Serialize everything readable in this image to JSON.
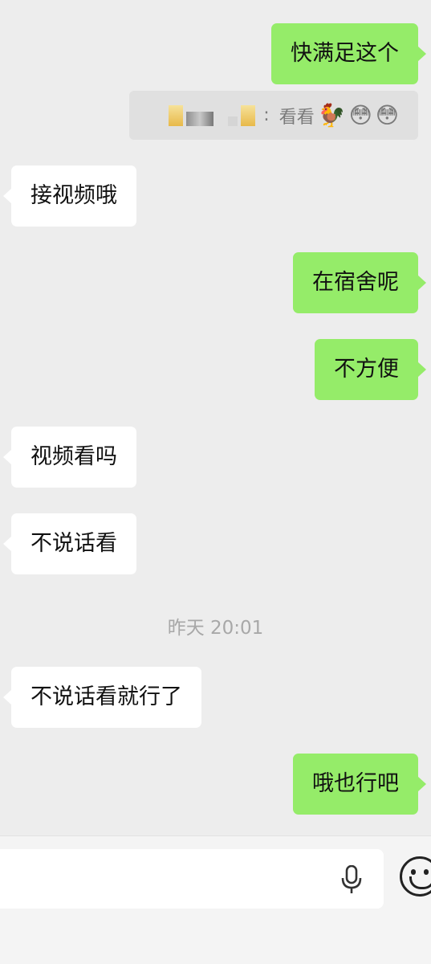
{
  "messages": [
    {
      "side": "me",
      "text": "快满足这个"
    },
    {
      "side": "them",
      "text": "接视频哦"
    },
    {
      "side": "me",
      "text": "在宿舍呢"
    },
    {
      "side": "me",
      "text": "不方便"
    },
    {
      "side": "them",
      "text": "视频看吗"
    },
    {
      "side": "them",
      "text": "不说话看"
    },
    {
      "side": "them",
      "text": "不说话看就行了"
    },
    {
      "side": "me",
      "text": "哦也行吧"
    }
  ],
  "quote": {
    "separator": ":",
    "text": "看看",
    "emojis": [
      "🐓",
      "😳",
      "😳"
    ]
  },
  "timestamp": "昨天 20:01",
  "colors": {
    "background": "#ededed",
    "my_bubble": "#95ec69",
    "their_bubble": "#ffffff",
    "quote_bg": "#e0e0e0"
  },
  "input_bar": {
    "icons": [
      "microphone-icon",
      "emoji-icon"
    ]
  }
}
